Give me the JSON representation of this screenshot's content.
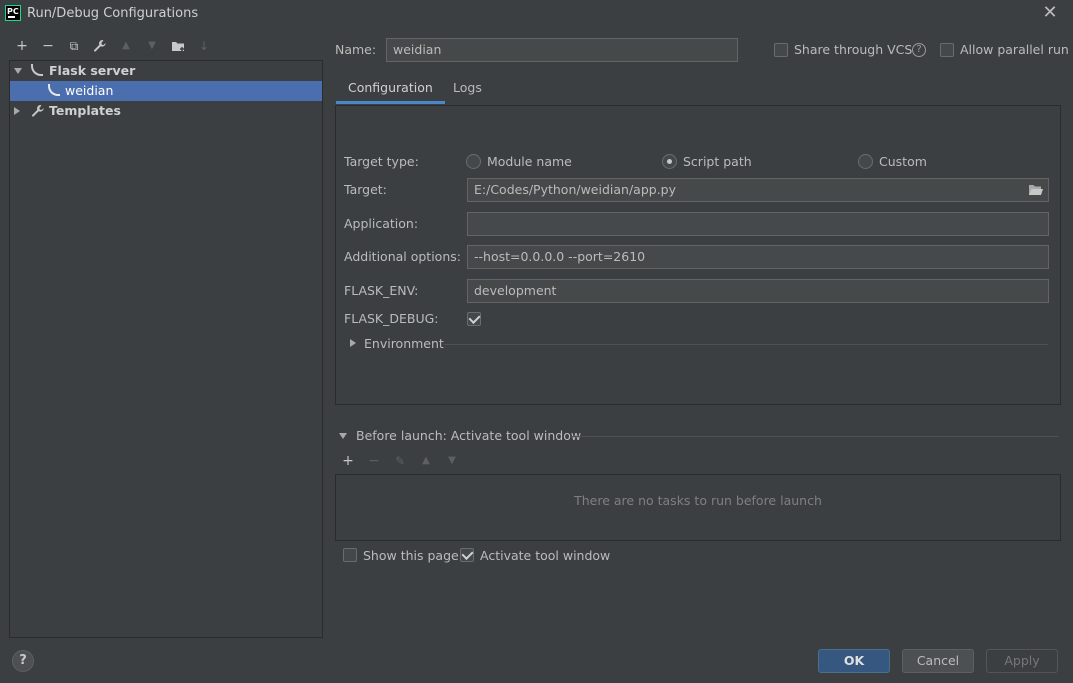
{
  "window": {
    "title": "Run/Debug Configurations",
    "app_logo": "PC"
  },
  "toolbar": {
    "add": "+",
    "remove": "−",
    "copy": "⧉",
    "edit": "🔧",
    "up": "▲",
    "down": "▼",
    "folder": "📁",
    "sort": "↓"
  },
  "tree": {
    "items": [
      {
        "label": "Flask server",
        "expanded": true
      },
      {
        "label": "weidian",
        "selected": true
      },
      {
        "label": "Templates",
        "expanded": false
      }
    ]
  },
  "name_field": {
    "label": "Name:",
    "value": "weidian"
  },
  "share_vcs": {
    "label": "Share through VCS",
    "checked": false
  },
  "allow_parallel": {
    "label": "Allow parallel run",
    "checked": false
  },
  "tabs": [
    {
      "label": "Configuration",
      "active": true
    },
    {
      "label": "Logs",
      "active": false
    }
  ],
  "config": {
    "target_type_label": "Target type:",
    "target_type_options": [
      "Module name",
      "Script path",
      "Custom"
    ],
    "target_type_selected": "Script path",
    "target_label": "Target:",
    "target_value": "E:/Codes/Python/weidian/app.py",
    "application_label": "Application:",
    "application_value": "",
    "additional_label": "Additional options:",
    "additional_value": "--host=0.0.0.0  --port=2610",
    "flask_env_label": "FLASK_ENV:",
    "flask_env_value": "development",
    "flask_debug_label": "FLASK_DEBUG:",
    "flask_debug_checked": true,
    "environment_label": "Environment"
  },
  "before_launch": {
    "header": "Before launch: Activate tool window",
    "empty_text": "There are no tasks to run before launch",
    "show_page_label": "Show this page",
    "show_page_checked": false,
    "activate_label": "Activate tool window",
    "activate_checked": true
  },
  "buttons": {
    "ok": "OK",
    "cancel": "Cancel",
    "apply": "Apply"
  },
  "colors": {
    "background": "#3c3f41",
    "selection": "#4b6eaf",
    "tab_underline": "#4a88c7",
    "primary_button": "#365880"
  }
}
